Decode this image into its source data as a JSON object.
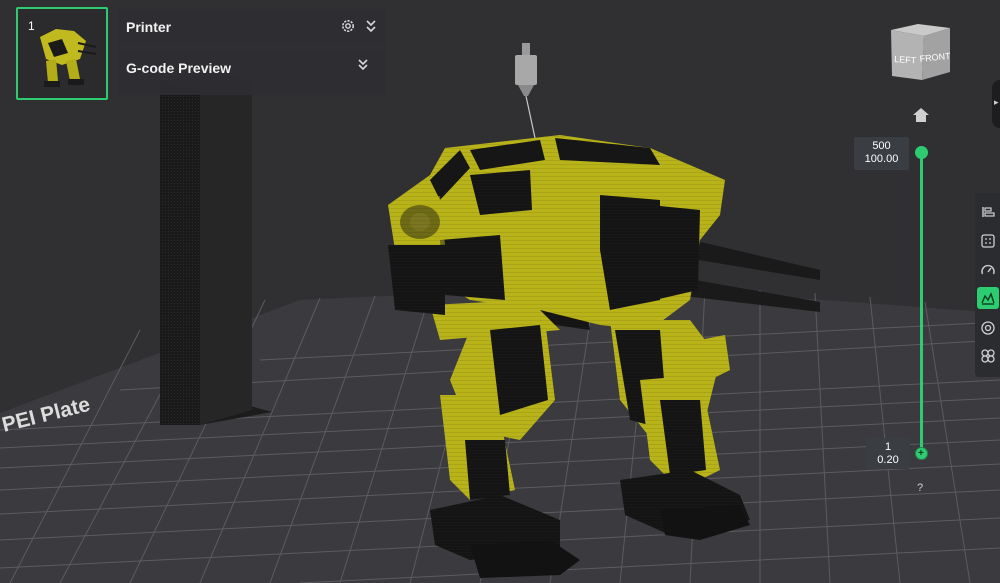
{
  "plate": {
    "number": "1",
    "bed_label": "PEI Plate"
  },
  "panels": {
    "printer_title": "Printer",
    "gcode_title": "G-code Preview"
  },
  "view_cube": {
    "left_label": "LEFT",
    "front_label": "FRONT"
  },
  "layer_slider": {
    "top_layer": "500",
    "top_height": "100.00",
    "bottom_layer": "1",
    "bottom_height": "0.20",
    "help": "?"
  },
  "colors": {
    "accent": "#2ecc71",
    "model": "#b9b31a",
    "background": "#303033"
  },
  "icons": [
    "home-icon",
    "settings-gear-icon",
    "collapse-chevron-icon",
    "toolbar-layers-icon",
    "toolbar-grid-icon",
    "toolbar-speed-icon",
    "toolbar-preview-icon",
    "toolbar-target-icon",
    "toolbar-assembly-icon"
  ]
}
